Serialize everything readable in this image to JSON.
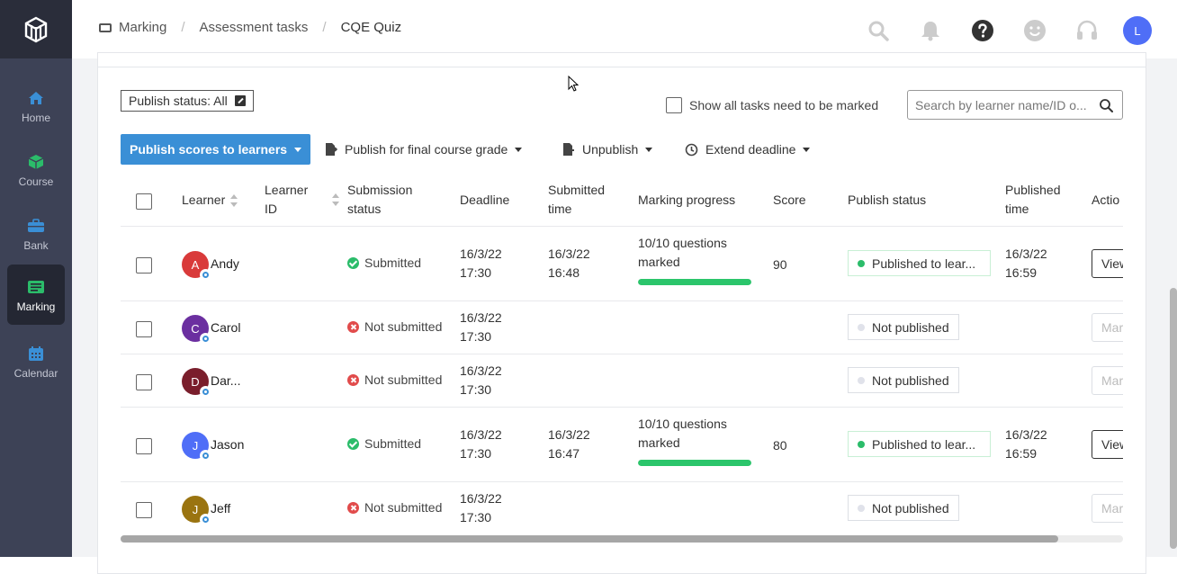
{
  "nav": {
    "items": [
      {
        "label": "Home",
        "icon": "home-icon"
      },
      {
        "label": "Course",
        "icon": "cube-icon"
      },
      {
        "label": "Bank",
        "icon": "briefcase-icon"
      },
      {
        "label": "Marking",
        "icon": "marking-icon",
        "active": true
      },
      {
        "label": "Calendar",
        "icon": "calendar-icon"
      }
    ]
  },
  "breadcrumb": [
    "Marking",
    "Assessment tasks",
    "CQE Quiz"
  ],
  "user": {
    "initial": "L"
  },
  "filters": {
    "publish_status": "Publish status: All",
    "show_all_label": "Show all tasks need to be marked",
    "search_placeholder": "Search by learner name/ID o..."
  },
  "toolbar": {
    "publish_scores": "Publish scores to learners",
    "publish_final": "Publish for final course grade",
    "unpublish": "Unpublish",
    "extend_deadline": "Extend deadline"
  },
  "table": {
    "headers": {
      "learner": "Learner",
      "learner_id_1": "Learner",
      "learner_id_2": "ID",
      "submission_1": "Submission",
      "submission_2": "status",
      "deadline": "Deadline",
      "submitted_1": "Submitted",
      "submitted_2": "time",
      "marking": "Marking progress",
      "score": "Score",
      "publish_status": "Publish status",
      "published_1": "Published",
      "published_2": "time",
      "actions": "Actio"
    },
    "rows": [
      {
        "initial": "A",
        "avatar_color": "#d93a3a",
        "name": "Andy",
        "status": "Submitted",
        "deadline_date": "16/3/22",
        "deadline_time": "17:30",
        "sub_date": "16/3/22",
        "sub_time": "16:48",
        "progress_1": "10/10 questions",
        "progress_2": "marked",
        "progress": 1.0,
        "score": "90",
        "publish": "Published to lear...",
        "pub_date": "16/3/22",
        "pub_time": "16:59",
        "action": "View"
      },
      {
        "initial": "C",
        "avatar_color": "#6b2fa0",
        "name": "Carol",
        "status": "Not submitted",
        "deadline_date": "16/3/22",
        "deadline_time": "17:30",
        "publish": "Not published",
        "action": "Mark"
      },
      {
        "initial": "D",
        "avatar_color": "#7a1e2c",
        "name": "Dar...",
        "status": "Not submitted",
        "deadline_date": "16/3/22",
        "deadline_time": "17:30",
        "publish": "Not published",
        "action": "Mark"
      },
      {
        "initial": "J",
        "avatar_color": "#4f6ef7",
        "name": "Jason",
        "status": "Submitted",
        "deadline_date": "16/3/22",
        "deadline_time": "17:30",
        "sub_date": "16/3/22",
        "sub_time": "16:47",
        "progress_1": "10/10 questions",
        "progress_2": "marked",
        "progress": 1.0,
        "score": "80",
        "publish": "Published to lear...",
        "pub_date": "16/3/22",
        "pub_time": "16:59",
        "action": "View"
      },
      {
        "initial": "J",
        "avatar_color": "#9a7410",
        "name": "Jeff",
        "status": "Not submitted",
        "deadline_date": "16/3/22",
        "deadline_time": "17:30",
        "publish": "Not published",
        "action": "Mark"
      }
    ]
  }
}
